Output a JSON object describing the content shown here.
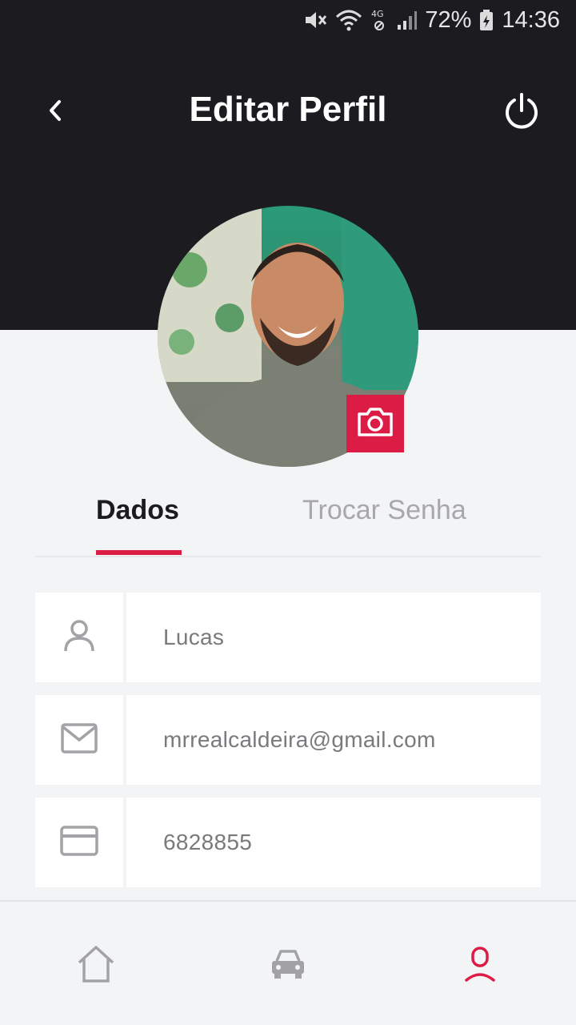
{
  "status_bar": {
    "battery_percent": "72%",
    "time": "14:36",
    "network_label": "4G",
    "icons": [
      "mute-icon",
      "wifi-icon",
      "network-4g-icon",
      "signal-icon",
      "battery-charging-icon"
    ]
  },
  "header": {
    "title": "Editar Perfil",
    "back_icon": "chevron-left-icon",
    "power_icon": "power-icon"
  },
  "profile": {
    "camera_icon": "camera-icon"
  },
  "tabs": [
    {
      "label": "Dados",
      "active": true
    },
    {
      "label": "Trocar Senha",
      "active": false
    }
  ],
  "fields": [
    {
      "icon": "user-icon",
      "value": "Lucas"
    },
    {
      "icon": "mail-icon",
      "value": "mrrealcaldeira@gmail.com"
    },
    {
      "icon": "card-icon",
      "value": "6828855"
    }
  ],
  "bottom_nav": [
    {
      "icon": "home-icon",
      "active": false
    },
    {
      "icon": "car-icon",
      "active": false
    },
    {
      "icon": "profile-icon",
      "active": true
    }
  ],
  "colors": {
    "header_bg": "#1b1b20",
    "accent": "#dd1c45",
    "page_bg": "#f3f4f6",
    "inactive_icon": "#a3a3a7"
  }
}
